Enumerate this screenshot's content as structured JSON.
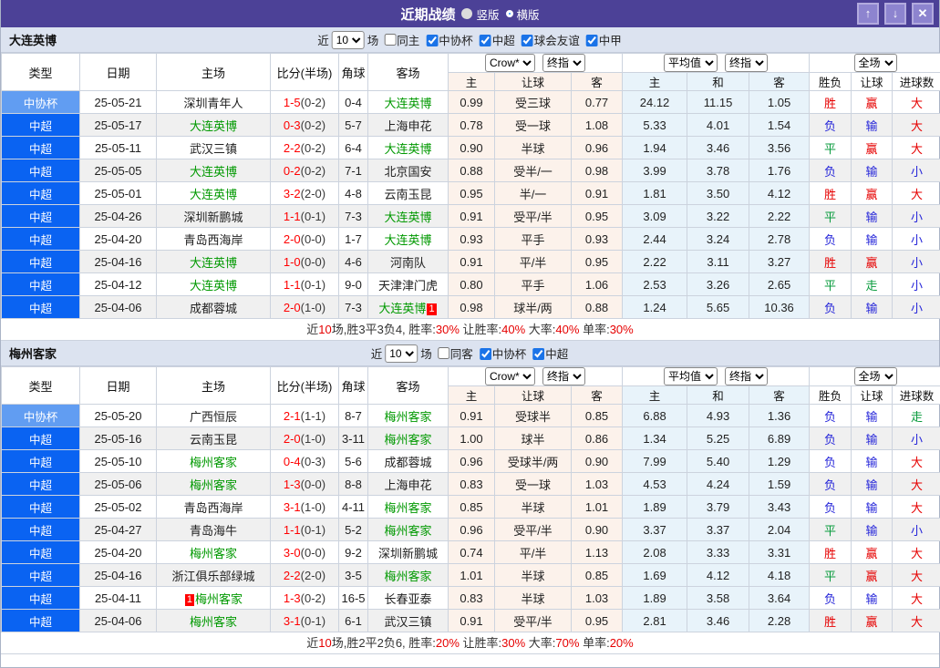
{
  "title_bar": {
    "title": "近期战绩",
    "vertical_label": "竖版",
    "horizontal_label": "横版",
    "up_glyph": "↑",
    "down_glyph": "↓",
    "close_glyph": "✕"
  },
  "colors": {
    "title_bar_bg": "#4c4197",
    "section_header_bg": "#dce3f0",
    "league_type_bg": "#0a63f2",
    "cup_type_bg": "#619df2",
    "win_red": "#e60000",
    "lose_blue": "#2626d9",
    "draw_green": "#089b3c",
    "team_green": "#009900",
    "score_red": "#ff0000",
    "odds_col_bg": "#fcf2eb",
    "avg_col_bg": "#e8f3fa"
  },
  "table_header": {
    "cols": [
      "类型",
      "日期",
      "主场",
      "比分(半场)",
      "角球",
      "客场"
    ],
    "g1": [
      "Crow*",
      "终指"
    ],
    "g2": [
      "平均值",
      "终指"
    ],
    "g3": [
      "全场"
    ],
    "sub_odds": [
      "主",
      "让球",
      "客"
    ],
    "sub_avg": [
      "主",
      "和",
      "客"
    ],
    "sub_res": [
      "胜负",
      "让球",
      "进球数"
    ]
  },
  "sections": [
    {
      "team": "大连英博",
      "filters": {
        "near_label": "近",
        "near_value": "10",
        "games_label": "场",
        "same_label": "同主",
        "same_checked": false,
        "leagues": [
          {
            "label": "中协杯",
            "checked": true
          },
          {
            "label": "中超",
            "checked": true
          },
          {
            "label": "球会友谊",
            "checked": true
          },
          {
            "label": "中甲",
            "checked": true
          }
        ]
      },
      "rows": [
        {
          "type": "中协杯",
          "cup": true,
          "date": "25-05-21",
          "home": {
            "name": "深圳青年人"
          },
          "score": "1-5",
          "half": "(0-2)",
          "corner": "0-4",
          "away": {
            "name": "大连英博",
            "green": true
          },
          "odds": [
            "0.99",
            "受三球",
            "0.77"
          ],
          "avg": [
            "24.12",
            "11.15",
            "1.05"
          ],
          "res": [
            [
              "胜",
              "r"
            ],
            [
              "赢",
              "r"
            ],
            [
              "大",
              "r"
            ]
          ]
        },
        {
          "type": "中超",
          "date": "25-05-17",
          "home": {
            "name": "大连英博",
            "green": true
          },
          "score": "0-3",
          "half": "(0-2)",
          "corner": "5-7",
          "away": {
            "name": "上海申花"
          },
          "odds": [
            "0.78",
            "受一球",
            "1.08"
          ],
          "avg": [
            "5.33",
            "4.01",
            "1.54"
          ],
          "res": [
            [
              "负",
              "b"
            ],
            [
              "输",
              "b"
            ],
            [
              "大",
              "r"
            ]
          ]
        },
        {
          "type": "中超",
          "date": "25-05-11",
          "home": {
            "name": "武汉三镇"
          },
          "score": "2-2",
          "half": "(0-2)",
          "corner": "6-4",
          "away": {
            "name": "大连英博",
            "green": true
          },
          "odds": [
            "0.90",
            "半球",
            "0.96"
          ],
          "avg": [
            "1.94",
            "3.46",
            "3.56"
          ],
          "res": [
            [
              "平",
              "g"
            ],
            [
              "赢",
              "r"
            ],
            [
              "大",
              "r"
            ]
          ]
        },
        {
          "type": "中超",
          "date": "25-05-05",
          "home": {
            "name": "大连英博",
            "green": true
          },
          "score": "0-2",
          "half": "(0-2)",
          "corner": "7-1",
          "away": {
            "name": "北京国安"
          },
          "odds": [
            "0.88",
            "受半/一",
            "0.98"
          ],
          "avg": [
            "3.99",
            "3.78",
            "1.76"
          ],
          "res": [
            [
              "负",
              "b"
            ],
            [
              "输",
              "b"
            ],
            [
              "小",
              "b"
            ]
          ]
        },
        {
          "type": "中超",
          "date": "25-05-01",
          "home": {
            "name": "大连英博",
            "green": true
          },
          "score": "3-2",
          "half": "(2-0)",
          "corner": "4-8",
          "away": {
            "name": "云南玉昆"
          },
          "odds": [
            "0.95",
            "半/一",
            "0.91"
          ],
          "avg": [
            "1.81",
            "3.50",
            "4.12"
          ],
          "res": [
            [
              "胜",
              "r"
            ],
            [
              "赢",
              "r"
            ],
            [
              "大",
              "r"
            ]
          ]
        },
        {
          "type": "中超",
          "date": "25-04-26",
          "home": {
            "name": "深圳新鹏城"
          },
          "score": "1-1",
          "half": "(0-1)",
          "corner": "7-3",
          "away": {
            "name": "大连英博",
            "green": true
          },
          "odds": [
            "0.91",
            "受平/半",
            "0.95"
          ],
          "avg": [
            "3.09",
            "3.22",
            "2.22"
          ],
          "res": [
            [
              "平",
              "g"
            ],
            [
              "输",
              "b"
            ],
            [
              "小",
              "b"
            ]
          ]
        },
        {
          "type": "中超",
          "date": "25-04-20",
          "home": {
            "name": "青岛西海岸"
          },
          "score": "2-0",
          "half": "(0-0)",
          "corner": "1-7",
          "away": {
            "name": "大连英博",
            "green": true
          },
          "odds": [
            "0.93",
            "平手",
            "0.93"
          ],
          "avg": [
            "2.44",
            "3.24",
            "2.78"
          ],
          "res": [
            [
              "负",
              "b"
            ],
            [
              "输",
              "b"
            ],
            [
              "小",
              "b"
            ]
          ]
        },
        {
          "type": "中超",
          "date": "25-04-16",
          "home": {
            "name": "大连英博",
            "green": true
          },
          "score": "1-0",
          "half": "(0-0)",
          "corner": "4-6",
          "away": {
            "name": "河南队"
          },
          "odds": [
            "0.91",
            "平/半",
            "0.95"
          ],
          "avg": [
            "2.22",
            "3.11",
            "3.27"
          ],
          "res": [
            [
              "胜",
              "r"
            ],
            [
              "赢",
              "r"
            ],
            [
              "小",
              "b"
            ]
          ]
        },
        {
          "type": "中超",
          "date": "25-04-12",
          "home": {
            "name": "大连英博",
            "green": true
          },
          "score": "1-1",
          "half": "(0-1)",
          "corner": "9-0",
          "away": {
            "name": "天津津门虎"
          },
          "odds": [
            "0.80",
            "平手",
            "1.06"
          ],
          "avg": [
            "2.53",
            "3.26",
            "2.65"
          ],
          "res": [
            [
              "平",
              "g"
            ],
            [
              "走",
              "g"
            ],
            [
              "小",
              "b"
            ]
          ]
        },
        {
          "type": "中超",
          "date": "25-04-06",
          "home": {
            "name": "成都蓉城"
          },
          "score": "2-0",
          "half": "(1-0)",
          "corner": "7-3",
          "away": {
            "name": "大连英博",
            "green": true,
            "badge": "1",
            "badge_pos": "after"
          },
          "odds": [
            "0.98",
            "球半/两",
            "0.88"
          ],
          "avg": [
            "1.24",
            "5.65",
            "10.36"
          ],
          "res": [
            [
              "负",
              "b"
            ],
            [
              "输",
              "b"
            ],
            [
              "小",
              "b"
            ]
          ]
        }
      ],
      "summary": [
        {
          "t": "近",
          "c": "k"
        },
        {
          "t": "10",
          "c": "r"
        },
        {
          "t": "场,胜3平3负4, 胜率:",
          "c": "k"
        },
        {
          "t": "30%",
          "c": "r"
        },
        {
          "t": " 让胜率:",
          "c": "k"
        },
        {
          "t": "40%",
          "c": "r"
        },
        {
          "t": " 大率:",
          "c": "k"
        },
        {
          "t": "40%",
          "c": "r"
        },
        {
          "t": " 单率:",
          "c": "k"
        },
        {
          "t": "30%",
          "c": "r"
        }
      ]
    },
    {
      "team": "梅州客家",
      "filters": {
        "near_label": "近",
        "near_value": "10",
        "games_label": "场",
        "same_label": "同客",
        "same_checked": false,
        "leagues": [
          {
            "label": "中协杯",
            "checked": true
          },
          {
            "label": "中超",
            "checked": true
          }
        ]
      },
      "rows": [
        {
          "type": "中协杯",
          "cup": true,
          "date": "25-05-20",
          "home": {
            "name": "广西恒辰"
          },
          "score": "2-1",
          "half": "(1-1)",
          "corner": "8-7",
          "away": {
            "name": "梅州客家",
            "green": true
          },
          "odds": [
            "0.91",
            "受球半",
            "0.85"
          ],
          "avg": [
            "6.88",
            "4.93",
            "1.36"
          ],
          "res": [
            [
              "负",
              "b"
            ],
            [
              "输",
              "b"
            ],
            [
              "走",
              "g"
            ]
          ]
        },
        {
          "type": "中超",
          "date": "25-05-16",
          "home": {
            "name": "云南玉昆"
          },
          "score": "2-0",
          "half": "(1-0)",
          "corner": "3-11",
          "away": {
            "name": "梅州客家",
            "green": true
          },
          "odds": [
            "1.00",
            "球半",
            "0.86"
          ],
          "avg": [
            "1.34",
            "5.25",
            "6.89"
          ],
          "res": [
            [
              "负",
              "b"
            ],
            [
              "输",
              "b"
            ],
            [
              "小",
              "b"
            ]
          ]
        },
        {
          "type": "中超",
          "date": "25-05-10",
          "home": {
            "name": "梅州客家",
            "green": true
          },
          "score": "0-4",
          "half": "(0-3)",
          "corner": "5-6",
          "away": {
            "name": "成都蓉城"
          },
          "odds": [
            "0.96",
            "受球半/两",
            "0.90"
          ],
          "avg": [
            "7.99",
            "5.40",
            "1.29"
          ],
          "res": [
            [
              "负",
              "b"
            ],
            [
              "输",
              "b"
            ],
            [
              "大",
              "r"
            ]
          ]
        },
        {
          "type": "中超",
          "date": "25-05-06",
          "home": {
            "name": "梅州客家",
            "green": true
          },
          "score": "1-3",
          "half": "(0-0)",
          "corner": "8-8",
          "away": {
            "name": "上海申花"
          },
          "odds": [
            "0.83",
            "受一球",
            "1.03"
          ],
          "avg": [
            "4.53",
            "4.24",
            "1.59"
          ],
          "res": [
            [
              "负",
              "b"
            ],
            [
              "输",
              "b"
            ],
            [
              "大",
              "r"
            ]
          ]
        },
        {
          "type": "中超",
          "date": "25-05-02",
          "home": {
            "name": "青岛西海岸"
          },
          "score": "3-1",
          "half": "(1-0)",
          "corner": "4-11",
          "away": {
            "name": "梅州客家",
            "green": true
          },
          "odds": [
            "0.85",
            "半球",
            "1.01"
          ],
          "avg": [
            "1.89",
            "3.79",
            "3.43"
          ],
          "res": [
            [
              "负",
              "b"
            ],
            [
              "输",
              "b"
            ],
            [
              "大",
              "r"
            ]
          ]
        },
        {
          "type": "中超",
          "date": "25-04-27",
          "home": {
            "name": "青岛海牛"
          },
          "score": "1-1",
          "half": "(0-1)",
          "corner": "5-2",
          "away": {
            "name": "梅州客家",
            "green": true
          },
          "odds": [
            "0.96",
            "受平/半",
            "0.90"
          ],
          "avg": [
            "3.37",
            "3.37",
            "2.04"
          ],
          "res": [
            [
              "平",
              "g"
            ],
            [
              "输",
              "b"
            ],
            [
              "小",
              "b"
            ]
          ]
        },
        {
          "type": "中超",
          "date": "25-04-20",
          "home": {
            "name": "梅州客家",
            "green": true
          },
          "score": "3-0",
          "half": "(0-0)",
          "corner": "9-2",
          "away": {
            "name": "深圳新鹏城"
          },
          "odds": [
            "0.74",
            "平/半",
            "1.13"
          ],
          "avg": [
            "2.08",
            "3.33",
            "3.31"
          ],
          "res": [
            [
              "胜",
              "r"
            ],
            [
              "赢",
              "r"
            ],
            [
              "大",
              "r"
            ]
          ]
        },
        {
          "type": "中超",
          "date": "25-04-16",
          "home": {
            "name": "浙江俱乐部绿城"
          },
          "score": "2-2",
          "half": "(2-0)",
          "corner": "3-5",
          "away": {
            "name": "梅州客家",
            "green": true
          },
          "odds": [
            "1.01",
            "半球",
            "0.85"
          ],
          "avg": [
            "1.69",
            "4.12",
            "4.18"
          ],
          "res": [
            [
              "平",
              "g"
            ],
            [
              "赢",
              "r"
            ],
            [
              "大",
              "r"
            ]
          ]
        },
        {
          "type": "中超",
          "date": "25-04-11",
          "home": {
            "name": "梅州客家",
            "green": true,
            "badge": "1",
            "badge_pos": "before"
          },
          "score": "1-3",
          "half": "(0-2)",
          "corner": "16-5",
          "away": {
            "name": "长春亚泰"
          },
          "odds": [
            "0.83",
            "半球",
            "1.03"
          ],
          "avg": [
            "1.89",
            "3.58",
            "3.64"
          ],
          "res": [
            [
              "负",
              "b"
            ],
            [
              "输",
              "b"
            ],
            [
              "大",
              "r"
            ]
          ]
        },
        {
          "type": "中超",
          "date": "25-04-06",
          "home": {
            "name": "梅州客家",
            "green": true
          },
          "score": "3-1",
          "half": "(0-1)",
          "corner": "6-1",
          "away": {
            "name": "武汉三镇"
          },
          "odds": [
            "0.91",
            "受平/半",
            "0.95"
          ],
          "avg": [
            "2.81",
            "3.46",
            "2.28"
          ],
          "res": [
            [
              "胜",
              "r"
            ],
            [
              "赢",
              "r"
            ],
            [
              "大",
              "r"
            ]
          ]
        }
      ],
      "summary": [
        {
          "t": "近",
          "c": "k"
        },
        {
          "t": "10",
          "c": "r"
        },
        {
          "t": "场,胜2平2负6, 胜率:",
          "c": "k"
        },
        {
          "t": "20%",
          "c": "r"
        },
        {
          "t": " 让胜率:",
          "c": "k"
        },
        {
          "t": "30%",
          "c": "r"
        },
        {
          "t": " 大率:",
          "c": "k"
        },
        {
          "t": "70%",
          "c": "r"
        },
        {
          "t": " 单率:",
          "c": "k"
        },
        {
          "t": "20%",
          "c": "r"
        }
      ]
    }
  ]
}
